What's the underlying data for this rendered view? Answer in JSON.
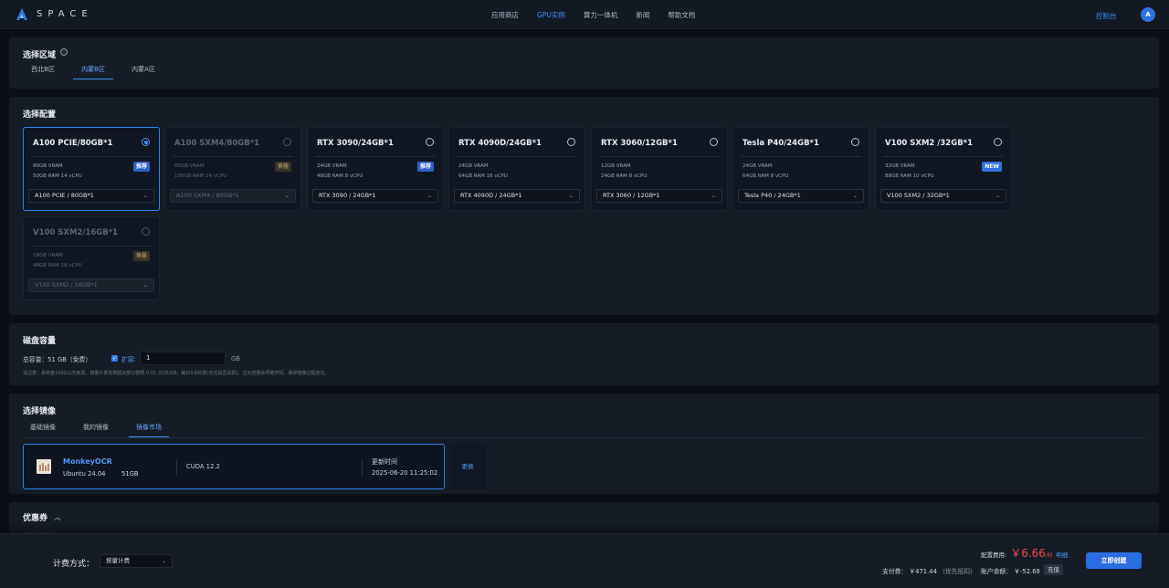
{
  "app": {
    "logo_text": "SPACE"
  },
  "nav": {
    "items": [
      "应用商店",
      "GPU实例",
      "算力一体机",
      "新闻",
      "帮助文档"
    ],
    "active": "GPU实例",
    "console": "控制台",
    "avatar": "A"
  },
  "region": {
    "title": "选择区域",
    "info_icon": "ⓘ",
    "tabs": [
      "西北B区",
      "内蒙B区",
      "内蒙A区"
    ],
    "active": "内蒙B区"
  },
  "config": {
    "title": "选择配置",
    "cards": [
      {
        "name": "A100 PCIE/80GB*1",
        "spec1": "80GB VRAM",
        "spec2": "50GB RAM 14 vCPU",
        "tag": "推荐",
        "option": "A100 PCIE / 80GB*1",
        "selected": true,
        "disabled": false
      },
      {
        "name": "A100 SXM4/80GB*1",
        "spec1": "80GB VRAM",
        "spec2": "100GB RAM 14 vCPU",
        "tag": "售罄",
        "option": "A100 SXM4 / 80GB*1",
        "selected": false,
        "disabled": true
      },
      {
        "name": "RTX 3090/24GB*1",
        "spec1": "24GB VRAM",
        "spec2": "48GB RAM 8 vCPU",
        "tag": "推荐",
        "option": "RTX 3090 / 24GB*1",
        "selected": false,
        "disabled": false
      },
      {
        "name": "RTX 4090D/24GB*1",
        "spec1": "24GB VRAM",
        "spec2": "64GB RAM 16 vCPU",
        "tag": "",
        "option": "RTX 4090D / 24GB*1",
        "selected": false,
        "disabled": false
      },
      {
        "name": "RTX 3060/12GB*1",
        "spec1": "12GB VRAM",
        "spec2": "24GB RAM 8 vCPU",
        "tag": "",
        "option": "RTX 3060 / 12GB*1",
        "selected": false,
        "disabled": false
      },
      {
        "name": "Tesla P40/24GB*1",
        "spec1": "24GB VRAM",
        "spec2": "64GB RAM 8 vCPU",
        "tag": "",
        "option": "Tesla P40 / 24GB*1",
        "selected": false,
        "disabled": false
      },
      {
        "name": "V100 SXM2 /32GB*1",
        "spec1": "32GB VRAM",
        "spec2": "88GB RAM 10 vCPU",
        "tag": "NEW",
        "option": "V100 SXM2 / 32GB*1",
        "selected": false,
        "disabled": false
      },
      {
        "name": "V100 SXM2/16GB*1",
        "spec1": "16GB VRAM",
        "spec2": "48GB RAM 16 vCPU",
        "tag": "售罄",
        "option": "V100 SXM2 / 16GB*1",
        "selected": false,
        "disabled": true
      }
    ]
  },
  "disk": {
    "title": "磁盘容量",
    "total": "总容量：51 GB（免费）",
    "expand_label": "扩容:",
    "expand_value": "1",
    "unit": "GB",
    "note": "请注意：系统盘100G以内免费，按量计费实例超出部分按照 0.01 元/日/GB，每日0点扣费(无论是否关机)。过大容量会导致开机、保存镜像过程变长。"
  },
  "image": {
    "title": "选择镜像",
    "tabs": [
      "基础镜像",
      "我的镜像",
      "镜像市场"
    ],
    "active": "镜像市场",
    "selected": {
      "name": "MonkeyOCR",
      "os": "Ubuntu 24.04",
      "size": "51GB",
      "cuda": "CUDA 12.2",
      "updated_label": "更新时间",
      "updated_value": "2025-06-20 11:25:02"
    },
    "change_label": "更换"
  },
  "coupon": {
    "title": "优惠券",
    "chevron": "︿",
    "faded_text": "可用优惠券"
  },
  "footer": {
    "billing_label": "计费方式：",
    "billing_value": "按量计费",
    "fee_label": "配置费用:",
    "fee_currency": "￥",
    "fee_price": "6.66",
    "fee_unit": "/时",
    "fee_detail": "明细",
    "pay_label": "支付券：",
    "pay_value": "￥471.44",
    "pay_hint": "（优先抵扣）",
    "balance_label": "账户余额：",
    "balance_value": "￥-52.68",
    "recharge": "充值",
    "create": "立即创建"
  },
  "colors": {
    "accent": "#2f7fea",
    "price": "#f04848",
    "background": "#0c1016",
    "panel": "#161c25"
  }
}
